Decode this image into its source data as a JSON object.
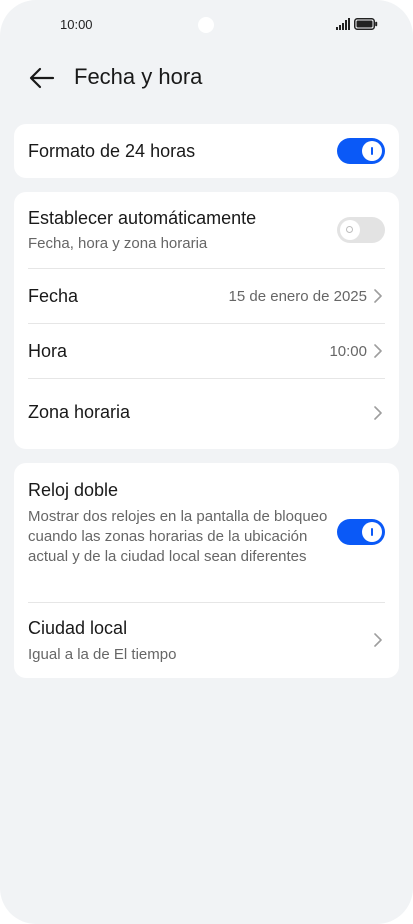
{
  "status_bar": {
    "time": "10:00",
    "signal_icon": "signal-icon",
    "battery_icon": "battery-icon"
  },
  "header": {
    "back_icon": "arrow-left-icon",
    "title": "Fecha y hora"
  },
  "settings": {
    "format_24h": {
      "label": "Formato de 24 horas",
      "enabled": true
    },
    "auto_set": {
      "label": "Establecer automáticamente",
      "sublabel": "Fecha, hora y zona horaria",
      "enabled": false
    },
    "date": {
      "label": "Fecha",
      "value": "15 de enero de 2025"
    },
    "time": {
      "label": "Hora",
      "value": "10:00"
    },
    "timezone": {
      "label": "Zona horaria"
    },
    "dual_clock": {
      "label": "Reloj doble",
      "sublabel": "Mostrar dos relojes en la pantalla de bloqueo cuando las zonas horarias de la ubicación actual y de la ciudad local sean diferentes",
      "enabled": true
    },
    "local_city": {
      "label": "Ciudad local",
      "sublabel": "Igual a la de El tiempo"
    }
  },
  "colors": {
    "accent": "#0a59f7",
    "background": "#f1f3f5",
    "card": "#ffffff",
    "toggle_off": "#e3e3e3"
  }
}
